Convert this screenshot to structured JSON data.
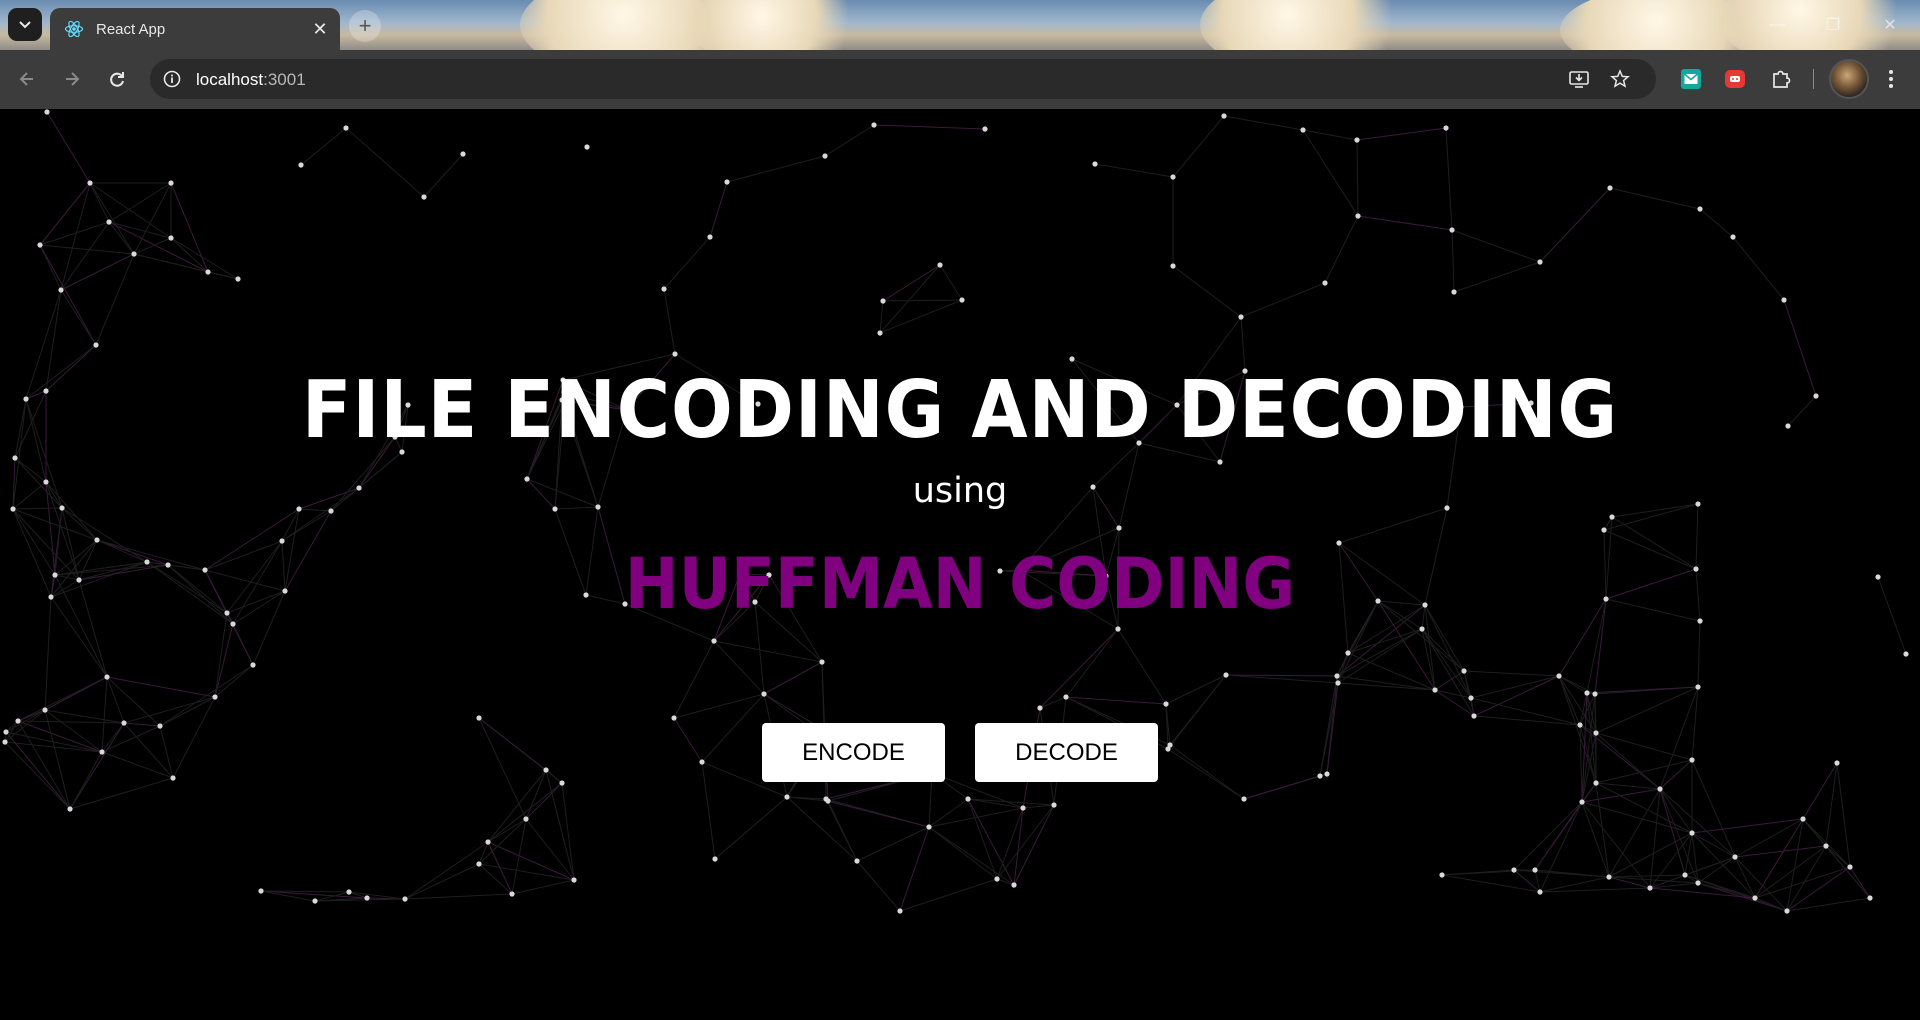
{
  "browser": {
    "tab": {
      "title": "React App",
      "close_glyph": "✕"
    },
    "new_tab_glyph": "+",
    "window_controls": {
      "minimize": "—",
      "restore": "❐",
      "close": "✕"
    },
    "address": {
      "host": "localhost",
      "port": ":3001"
    },
    "icons": {
      "tab_search": "chevron-down-icon",
      "favicon": "react-logo-icon",
      "back": "back-arrow-icon",
      "forward": "forward-arrow-icon",
      "reload": "reload-icon",
      "site_info": "info-icon",
      "install": "install-app-icon",
      "bookmark": "star-icon",
      "extension_1": "mail-extension-icon",
      "extension_2": "red-extension-icon",
      "extensions": "puzzle-icon",
      "profile": "avatar",
      "menu": "kebab-menu-icon"
    }
  },
  "page": {
    "title": "FILE ENCODING AND DECODING",
    "subtitle": "using",
    "algorithm": "HUFFMAN CODING",
    "buttons": {
      "encode": "ENCODE",
      "decode": "DECODE"
    }
  },
  "colors": {
    "background": "#000000",
    "title": "#ffffff",
    "accent": "#800080",
    "particle": "#d9d9d9",
    "particle_line": "#3a1a3a"
  }
}
